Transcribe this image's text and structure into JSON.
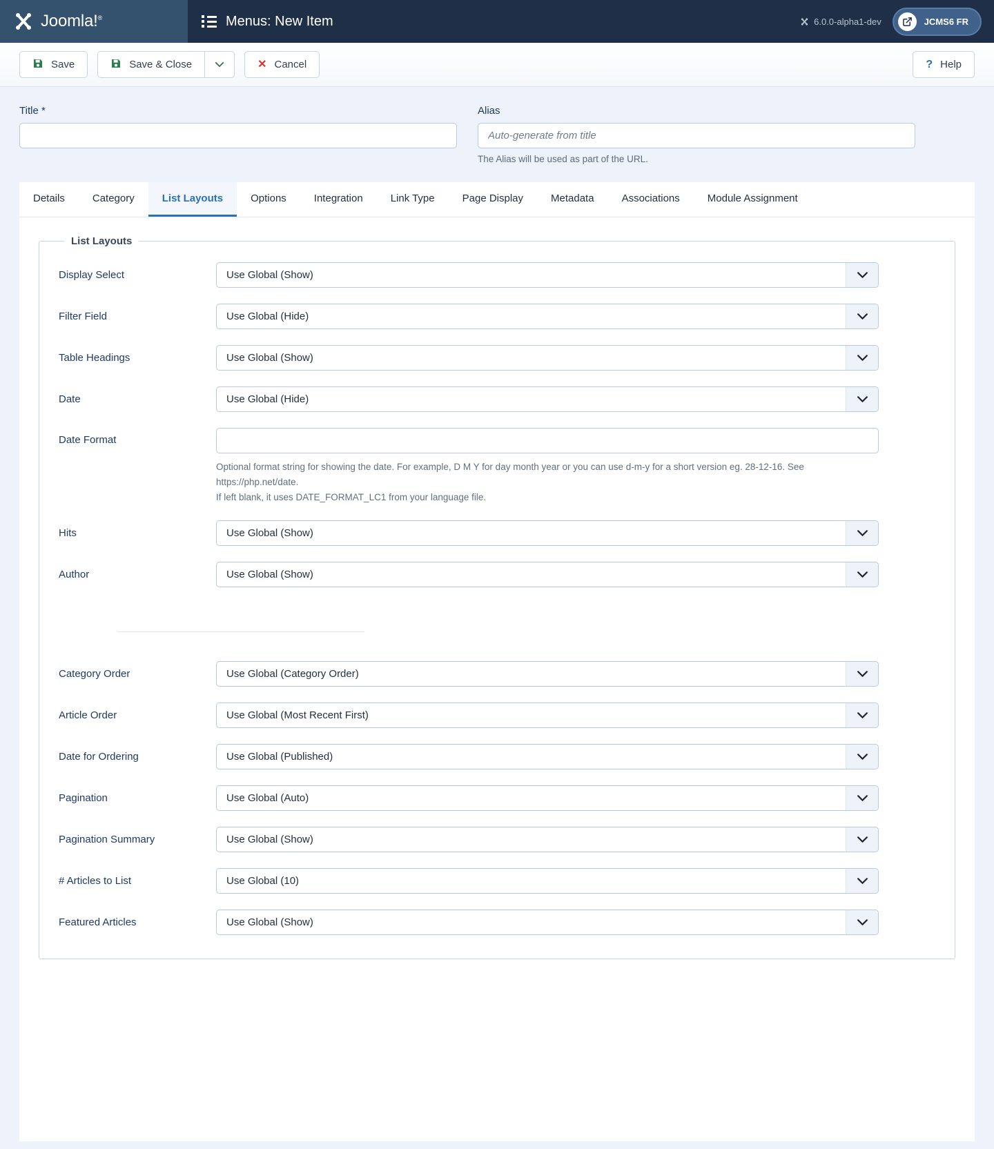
{
  "header": {
    "brand": "Joomla!",
    "brand_sup": "®",
    "menu_icon": "list-icon",
    "page_title": "Menus: New Item",
    "version": "6.0.0-alpha1-dev",
    "version_icon": "joomla-mark-icon",
    "site_button": "JCMS6 FR",
    "site_button_icon": "external-link-icon"
  },
  "toolbar": {
    "save_label": "Save",
    "save_close_label": "Save & Close",
    "save_dropdown_icon": "chevron-down-icon",
    "cancel_label": "Cancel",
    "help_label": "Help",
    "save_icon": "floppy-disk-icon",
    "cancel_icon": "x-icon",
    "help_icon": "question-mark-icon"
  },
  "top_fields": {
    "title": {
      "label": "Title *",
      "value": "",
      "placeholder": ""
    },
    "alias": {
      "label": "Alias",
      "value": "",
      "placeholder": "Auto-generate from title",
      "help": "The Alias will be used as part of the URL."
    }
  },
  "tabs": [
    {
      "label": "Details",
      "active": false
    },
    {
      "label": "Category",
      "active": false
    },
    {
      "label": "List Layouts",
      "active": true
    },
    {
      "label": "Options",
      "active": false
    },
    {
      "label": "Integration",
      "active": false
    },
    {
      "label": "Link Type",
      "active": false
    },
    {
      "label": "Page Display",
      "active": false
    },
    {
      "label": "Metadata",
      "active": false
    },
    {
      "label": "Associations",
      "active": false
    },
    {
      "label": "Module Assignment",
      "active": false
    }
  ],
  "fieldset": {
    "legend": "List Layouts",
    "fields_top": [
      {
        "label": "Display Select",
        "value": "Use Global (Show)"
      },
      {
        "label": "Filter Field",
        "value": "Use Global (Hide)"
      },
      {
        "label": "Table Headings",
        "value": "Use Global (Show)"
      },
      {
        "label": "Date",
        "value": "Use Global (Hide)"
      }
    ],
    "date_format": {
      "label": "Date Format",
      "value": "",
      "help_line1": "Optional format string for showing the date. For example, D M Y for day month year or you can use d-m-y for a short version eg. 28-12-16. See https://php.net/date.",
      "help_line2": "If left blank, it uses DATE_FORMAT_LC1 from your language file."
    },
    "fields_mid": [
      {
        "label": "Hits",
        "value": "Use Global (Show)"
      },
      {
        "label": "Author",
        "value": "Use Global (Show)"
      }
    ],
    "fields_bottom": [
      {
        "label": "Category Order",
        "value": "Use Global (Category Order)"
      },
      {
        "label": "Article Order",
        "value": "Use Global (Most Recent First)"
      },
      {
        "label": "Date for Ordering",
        "value": "Use Global (Published)"
      },
      {
        "label": "Pagination",
        "value": "Use Global (Auto)"
      },
      {
        "label": "Pagination Summary",
        "value": "Use Global (Show)"
      },
      {
        "label": "# Articles to List",
        "value": "Use Global (10)"
      },
      {
        "label": "Featured Articles",
        "value": "Use Global (Show)"
      }
    ]
  },
  "colors": {
    "header_bg": "#1f2f47",
    "brand_bg": "#34516d",
    "accent": "#2a6fb8",
    "save_green": "#2f7d4f",
    "cancel_red": "#d9342b",
    "page_bg": "#eef2fa"
  }
}
